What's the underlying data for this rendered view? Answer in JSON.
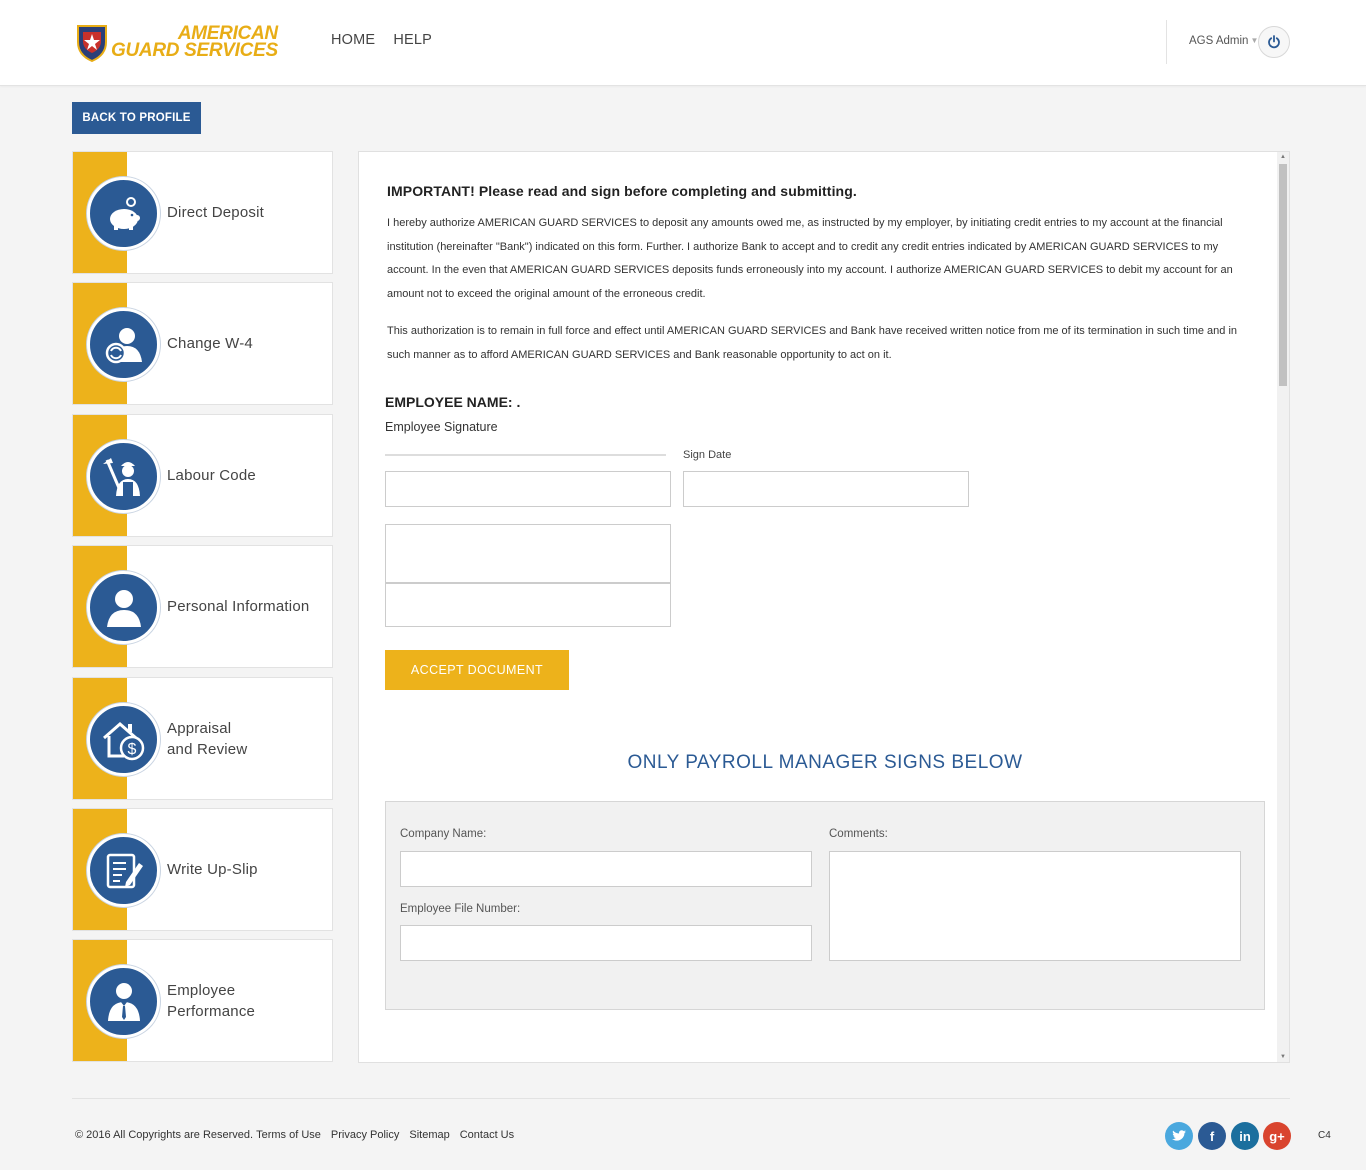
{
  "header": {
    "logo_line1": "AMERICAN",
    "logo_line2": "GUARD SERVICES",
    "nav": {
      "home": "HOME",
      "help": "HELP"
    },
    "user_name": "AGS Admin",
    "power_icon": "power-icon"
  },
  "back_button_label": "BACK TO PROFILE",
  "sidebar": {
    "items": [
      {
        "label": "Direct Deposit",
        "icon": "piggy-bank-icon"
      },
      {
        "label": "Change W-4",
        "icon": "user-refresh-icon"
      },
      {
        "label": "Labour Code",
        "icon": "worker-icon"
      },
      {
        "label": "Personal Information",
        "icon": "user-icon"
      },
      {
        "label_line1": "Appraisal",
        "label_line2": "and Review",
        "icon": "house-dollar-icon"
      },
      {
        "label": "Write Up-Slip",
        "icon": "document-pencil-icon"
      },
      {
        "label_line1": "Employee",
        "label_line2": "Performance",
        "icon": "business-person-icon"
      }
    ]
  },
  "document": {
    "important": "IMPORTANT! Please read and sign before completing and submitting.",
    "paragraph1": "I hereby authorize AMERICAN GUARD SERVICES to deposit any amounts owed me, as instructed by my employer, by initiating credit entries to my account at the financial institution (hereinafter \"Bank\") indicated on this form. Further. I authorize Bank to accept and to credit any credit entries indicated by AMERICAN GUARD SERVICES to my account. In the even that AMERICAN GUARD SERVICES deposits funds erroneously into my account. I authorize AMERICAN GUARD SERVICES to debit my account for an amount not to exceed the original amount of the erroneous credit.",
    "paragraph2": "This authorization is to remain in full force and effect until AMERICAN GUARD SERVICES and Bank have received written notice from me of its termination in such time and in such manner as to afford AMERICAN GUARD SERVICES and Bank reasonable opportunity to act on it.",
    "employee_name": "EMPLOYEE NAME: .",
    "employee_signature": "Employee Signature",
    "sign_date_label": "Sign Date",
    "accept_button": "ACCEPT DOCUMENT",
    "payroll_title": "ONLY PAYROLL MANAGER SIGNS BELOW",
    "company_name_label": "Company Name:",
    "employee_file_number_label": "Employee File Number:",
    "comments_label": "Comments:"
  },
  "footer": {
    "copyright": "© 2016 All Copyrights are Reserved.",
    "terms": "Terms of Use",
    "privacy": "Privacy Policy",
    "sitemap": "Sitemap",
    "contact": "Contact Us",
    "badge": "C4",
    "social": [
      "twitter-icon",
      "facebook-icon",
      "linkedin-icon",
      "google-plus-icon"
    ]
  },
  "colors": {
    "brand_blue": "#2b5a94",
    "brand_yellow": "#edb21b",
    "logo_gold": "#e8ad16"
  }
}
